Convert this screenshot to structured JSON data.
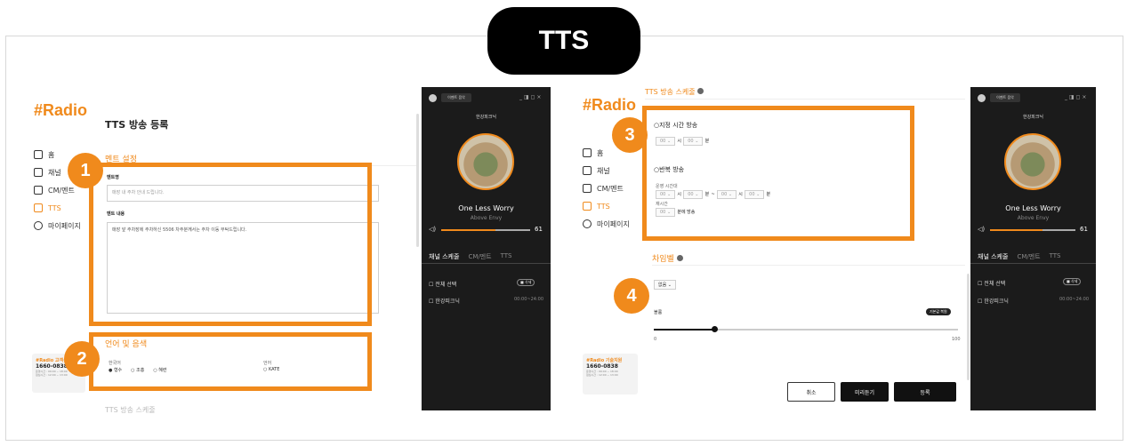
{
  "pill": {
    "label": "TTS"
  },
  "markers": [
    "1",
    "2",
    "3",
    "4"
  ],
  "left": {
    "logo": "#Radio",
    "nav": [
      "홈",
      "채널",
      "CM/멘트",
      "TTS",
      "마이페이지"
    ],
    "page_title": "TTS 방송 등록",
    "section_ment": "멘트 설정",
    "ment_name_label": "멘트명",
    "ment_name_placeholder": "매장 내 주차 안내 드립니다.",
    "ment_content_label": "멘트 내용",
    "ment_content_text": "매장 앞 주차장에 주차하신 5506 차주분께서는 주차 이동 부탁드립니다.",
    "section_lang": "언어 및 음색",
    "lang_label": "한국어",
    "voice_options": [
      "형수",
      "조홍",
      "혜련"
    ],
    "lang2_label": "언어",
    "lang2_value": "KATE",
    "support_title": "#Radio 고객센터",
    "support_phone": "1660-0838",
    "support_hours": [
      "운영시간 : 09:00 ~ 18:00",
      "점심시간 : 12:00 ~ 13:00"
    ],
    "bottom_section": "TTS 방송 스케줄"
  },
  "player": {
    "top_button": "이벤트 음악",
    "window_controls": "_ ◨ ◻ ×",
    "channel": "한강피크닉",
    "song": "One Less Worry",
    "artist": "Above Envy",
    "volume": "61",
    "volume_level": 0.61,
    "tabs": [
      "채널 스케줄",
      "CM/멘트",
      "TTS"
    ],
    "select_all": "전체 선택",
    "delete_btn": "■ 삭제",
    "row_name": "한강피크닉",
    "row_time": "00:00~24:00"
  },
  "right": {
    "logo": "#Radio",
    "schedule_title": "TTS 방송 스케줄",
    "fixed_label": "지정 시간 방송",
    "hour_val": "00",
    "hour_unit": "시",
    "min_val": "00",
    "min_unit": "분",
    "repeat_label": "반복 방송",
    "run_time_label": "운영 시간대",
    "tilde": "~",
    "interval_label": "재시간",
    "interval_unit": "분에 방송",
    "chime_title": "차임벨",
    "chime_select": "없음",
    "volume_label": "볼륨",
    "reset_btn": "기본값 복원",
    "slider_min": "0",
    "slider_max": "100",
    "slider_level": 0.2,
    "support_title": "#Radio 기술지원",
    "support_phone": "1660-0838",
    "support_hours": [
      "운영시간 : 09:00 ~ 18:00",
      "점심시간 : 12:00 ~ 13:00"
    ],
    "cancel_btn": "취소",
    "preview_btn": "미리듣기",
    "register_btn": "등록"
  },
  "colors": {
    "accent": "#f08a1c",
    "dark": "#1b1b1b"
  }
}
